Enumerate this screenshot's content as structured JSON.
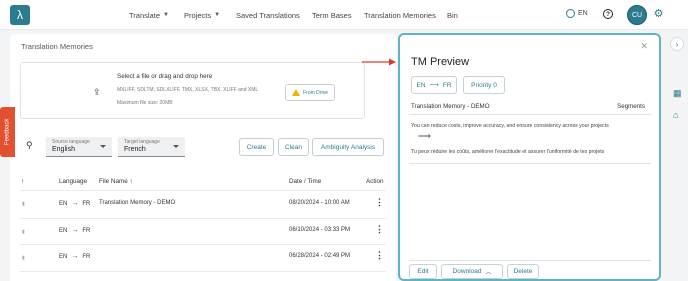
{
  "nav": {
    "logo": "λ",
    "items": [
      {
        "label": "Translate",
        "dropdown": true
      },
      {
        "label": "Projects",
        "dropdown": true
      },
      {
        "label": "Saved Translations",
        "dropdown": false
      },
      {
        "label": "Term Bases",
        "dropdown": false
      },
      {
        "label": "Translation Memories",
        "dropdown": false
      },
      {
        "label": "Bin",
        "dropdown": false
      }
    ],
    "language": "EN",
    "help": "?",
    "avatar": "CU",
    "settings_icon": "gear-icon"
  },
  "card": {
    "title": "Translation Memories",
    "dropzone": {
      "title": "Select a file or drag and drop here",
      "formats": "MXLIFF, SDLTM, SDLXLIFF, TMX, XLSX, TBX, XLIFF and XML",
      "max_size": "Maximum file size: 20MB",
      "drive_button": "From Drive"
    },
    "source_language": {
      "label": "Source language",
      "value": "English"
    },
    "target_language": {
      "label": "Target language",
      "value": "French"
    },
    "buttons": {
      "create": "Create",
      "clean": "Clean",
      "ambiguity": "Ambiguity Analysis"
    },
    "table": {
      "headers": {
        "language": "Language",
        "file_name": "File Name",
        "date_time": "Date / Time",
        "action": "Action"
      },
      "rows": [
        {
          "source": "EN",
          "target": "FR",
          "name": "Translation Memory - DEMO",
          "date": "08/20/2024 - 10:00 AM"
        },
        {
          "source": "EN",
          "target": "FR",
          "name": "",
          "date": "06/10/2024 - 03:33 PM"
        },
        {
          "source": "EN",
          "target": "FR",
          "name": "",
          "date": "06/28/2024 - 02:49 PM"
        }
      ]
    }
  },
  "feedback": "Feedback",
  "preview": {
    "title": "TM Preview",
    "source": "EN",
    "target": "FR",
    "priority": "Priority 0",
    "tm_name": "Translation Memory - DEMO",
    "segments_label": "Segments",
    "source_text": "You can reduce costs, improve accuracy, and ensure consistency across your projects",
    "target_text": "Tu peux réduire les coûts, améliorer l'exactitude et assurer l'uniformité de tes projets",
    "buttons": {
      "edit": "Edit",
      "download": "Download",
      "delete": "Delete"
    }
  },
  "colors": {
    "accent": "#2b7c8f",
    "feedback": "#e2512f",
    "arrow": "#e03a2f",
    "panel_border": "#5fb3c2"
  }
}
